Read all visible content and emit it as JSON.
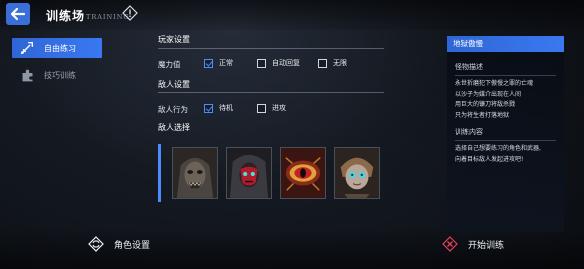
{
  "header": {
    "title": "训练场",
    "title_en": "TRAINING",
    "back_icon": "back-arrow-icon",
    "help_icon": "warning-icon"
  },
  "sidebar": {
    "items": [
      {
        "label": "自由练习",
        "icon": "sword-icon",
        "active": true
      },
      {
        "label": "技巧训练",
        "icon": "puzzle-icon",
        "active": false
      }
    ]
  },
  "player_settings": {
    "title": "玩家设置",
    "row_label": "魔力值",
    "options": [
      {
        "label": "正常",
        "checked": true
      },
      {
        "label": "自动回复",
        "checked": false
      },
      {
        "label": "无限",
        "checked": false
      }
    ]
  },
  "enemy_settings": {
    "title": "敌人设置",
    "row_label": "敌人行为",
    "options": [
      {
        "label": "待机",
        "checked": true
      },
      {
        "label": "进攻",
        "checked": false
      }
    ]
  },
  "enemy_select": {
    "title": "敌人选择",
    "enemies": [
      {
        "icon": "ghoul-portrait"
      },
      {
        "icon": "red-mask-portrait"
      },
      {
        "icon": "eye-monster-portrait"
      },
      {
        "icon": "doll-portrait"
      }
    ]
  },
  "info_panel": {
    "title": "地狱傲慢",
    "desc_title": "怪物描述",
    "desc_lines": [
      "永世折磨犯下傲慢之罪的亡魂",
      "以沙子为媒介出现在人间",
      "用巨大的镰刀将敌杀戮",
      "只为将生者打落地狱"
    ],
    "train_title": "训练内容",
    "train_lines": [
      "选择自己想要练习的角色和武器,",
      "向着目标敌人发起进攻吧!"
    ]
  },
  "footer": {
    "character_settings": "角色设置",
    "start_training": "开始训练"
  },
  "colors": {
    "accent": "#3a78f0",
    "check": "#4d8cff",
    "start_icon": "#e0425a"
  }
}
